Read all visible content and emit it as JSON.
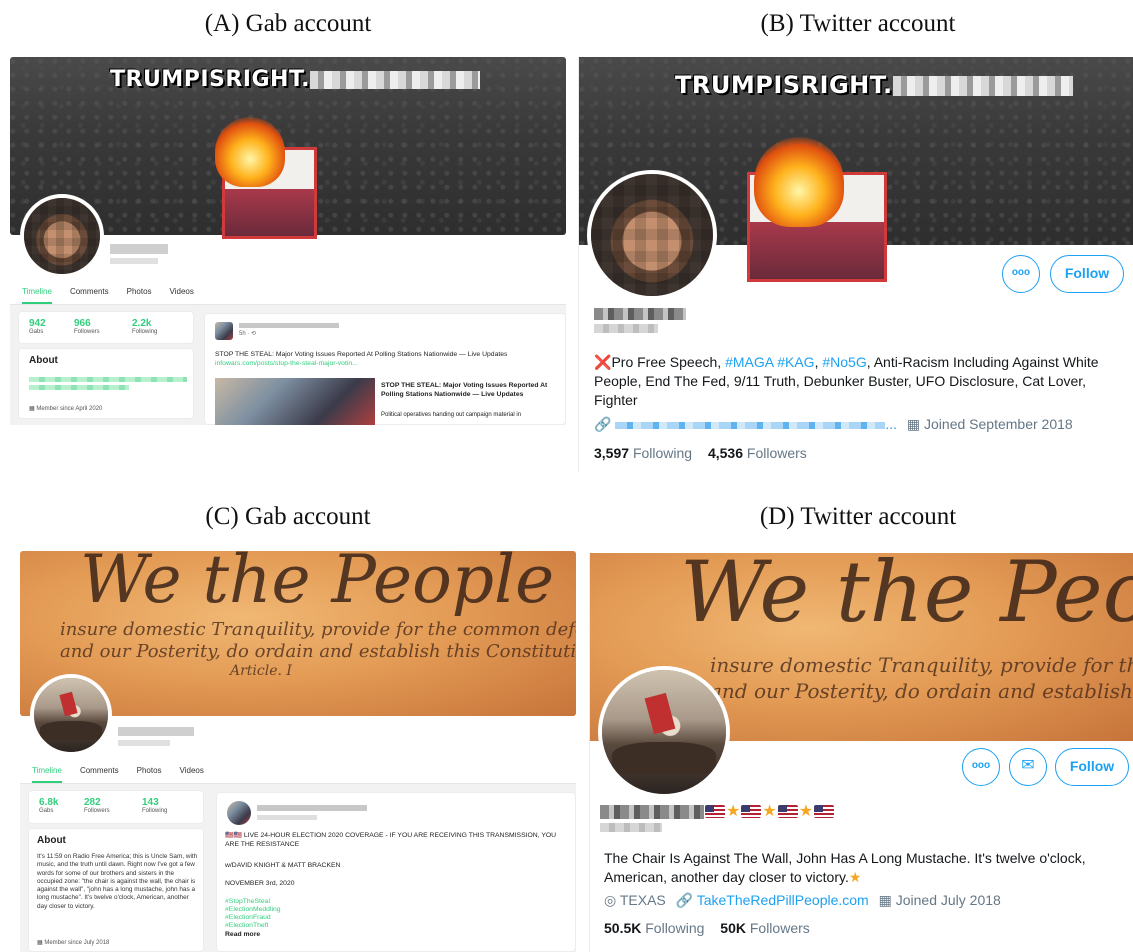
{
  "captions": {
    "a": "(A) Gab account",
    "b": "(B) Twitter account",
    "c": "(C) Gab account",
    "d": "(D) Twitter account"
  },
  "banner": {
    "trump_text": "TRUMPISRIGHT."
  },
  "gab_a": {
    "tabs": [
      "Timeline",
      "Comments",
      "Photos",
      "Videos"
    ],
    "stats": [
      {
        "value": "942",
        "label": "Gabs"
      },
      {
        "value": "966",
        "label": "Followers"
      },
      {
        "value": "2.2k",
        "label": "Following"
      }
    ],
    "about_heading": "About",
    "member_since": "Member since April 2020",
    "post_time": "5h · ",
    "post_text": "STOP THE STEAL: Major Voting Issues Reported At Polling Stations Nationwide — Live Updates",
    "post_link": "infowars.com/posts/stop-the-steal-major-votin...",
    "card_title": "STOP THE STEAL: Major Voting Issues Reported At Polling Stations Nationwide — Live Updates",
    "card_desc": "Political operatives handing out campaign material in"
  },
  "twitter_b": {
    "follow_label": "Follow",
    "more_label": "ooo",
    "bio_cross": "❌",
    "bio_parts": {
      "p1": "Pro Free Speech, ",
      "h1": "#MAGA",
      "h2": "#KAG",
      "sep1": ", ",
      "h3": "#No5G",
      "p2": ", Anti-Racism Including Against White People, End The Fed, 9/11 Truth, Debunker Buster, UFO Disclosure, Cat Lover, Fighter"
    },
    "link_suffix": "...",
    "joined": "Joined September 2018",
    "following_count": "3,597",
    "following_label": "Following",
    "followers_count": "4,536",
    "followers_label": "Followers"
  },
  "gab_c": {
    "tabs": [
      "Timeline",
      "Comments",
      "Photos",
      "Videos"
    ],
    "stats": [
      {
        "value": "6.8k",
        "label": "Gabs"
      },
      {
        "value": "282",
        "label": "Followers"
      },
      {
        "value": "143",
        "label": "Following"
      }
    ],
    "about_heading": "About",
    "about_text": "It's 11:59 on Radio Free America; this is Uncle Sam, with music, and the truth until dawn. Right now I've got a few words for some of our brothers and sisters in the occupied zone: \"the chair is against the wall, the chair is against the wall\", \"john has a long mustache, john has a long mustache\". It's twelve o'clock, American, another day closer to victory.",
    "member_since": "Member since July 2018",
    "post_line1": "LIVE 24-HOUR ELECTION 2020 COVERAGE - IF YOU ARE RECEIVING THIS TRANSMISSION, YOU ARE THE RESISTANCE",
    "post_line2": "w/DAVID KNIGHT & MATT BRACKEN",
    "post_line3": "NOVEMBER 3rd, 2020",
    "hashtags": [
      "#StopTheSteal",
      "#ElectionMeddling",
      "#ElectionFraud",
      "#ElectionTheft"
    ],
    "read_more": "Read more"
  },
  "twitter_d": {
    "follow_label": "Follow",
    "more_label": "ooo",
    "mail_label": "✉",
    "bio": "The Chair Is Against The Wall, John Has A Long Mustache. It's twelve o'clock, American, another day closer to victory.",
    "location": "TEXAS",
    "link": "TakeTheRedPillPeople.com",
    "joined": "Joined July 2018",
    "following_count": "50.5K",
    "following_label": "Following",
    "followers_count": "50K",
    "followers_label": "Followers"
  },
  "wtp_text": {
    "big": "We the People",
    "line1": "insure domestic Tranquility, provide for the common defence",
    "line2": "and our Posterity, do ordain and establish this Constitution",
    "article": "Article. I"
  },
  "colors": {
    "gab_green": "#30ce7d",
    "twitter_blue": "#1da1f2"
  }
}
